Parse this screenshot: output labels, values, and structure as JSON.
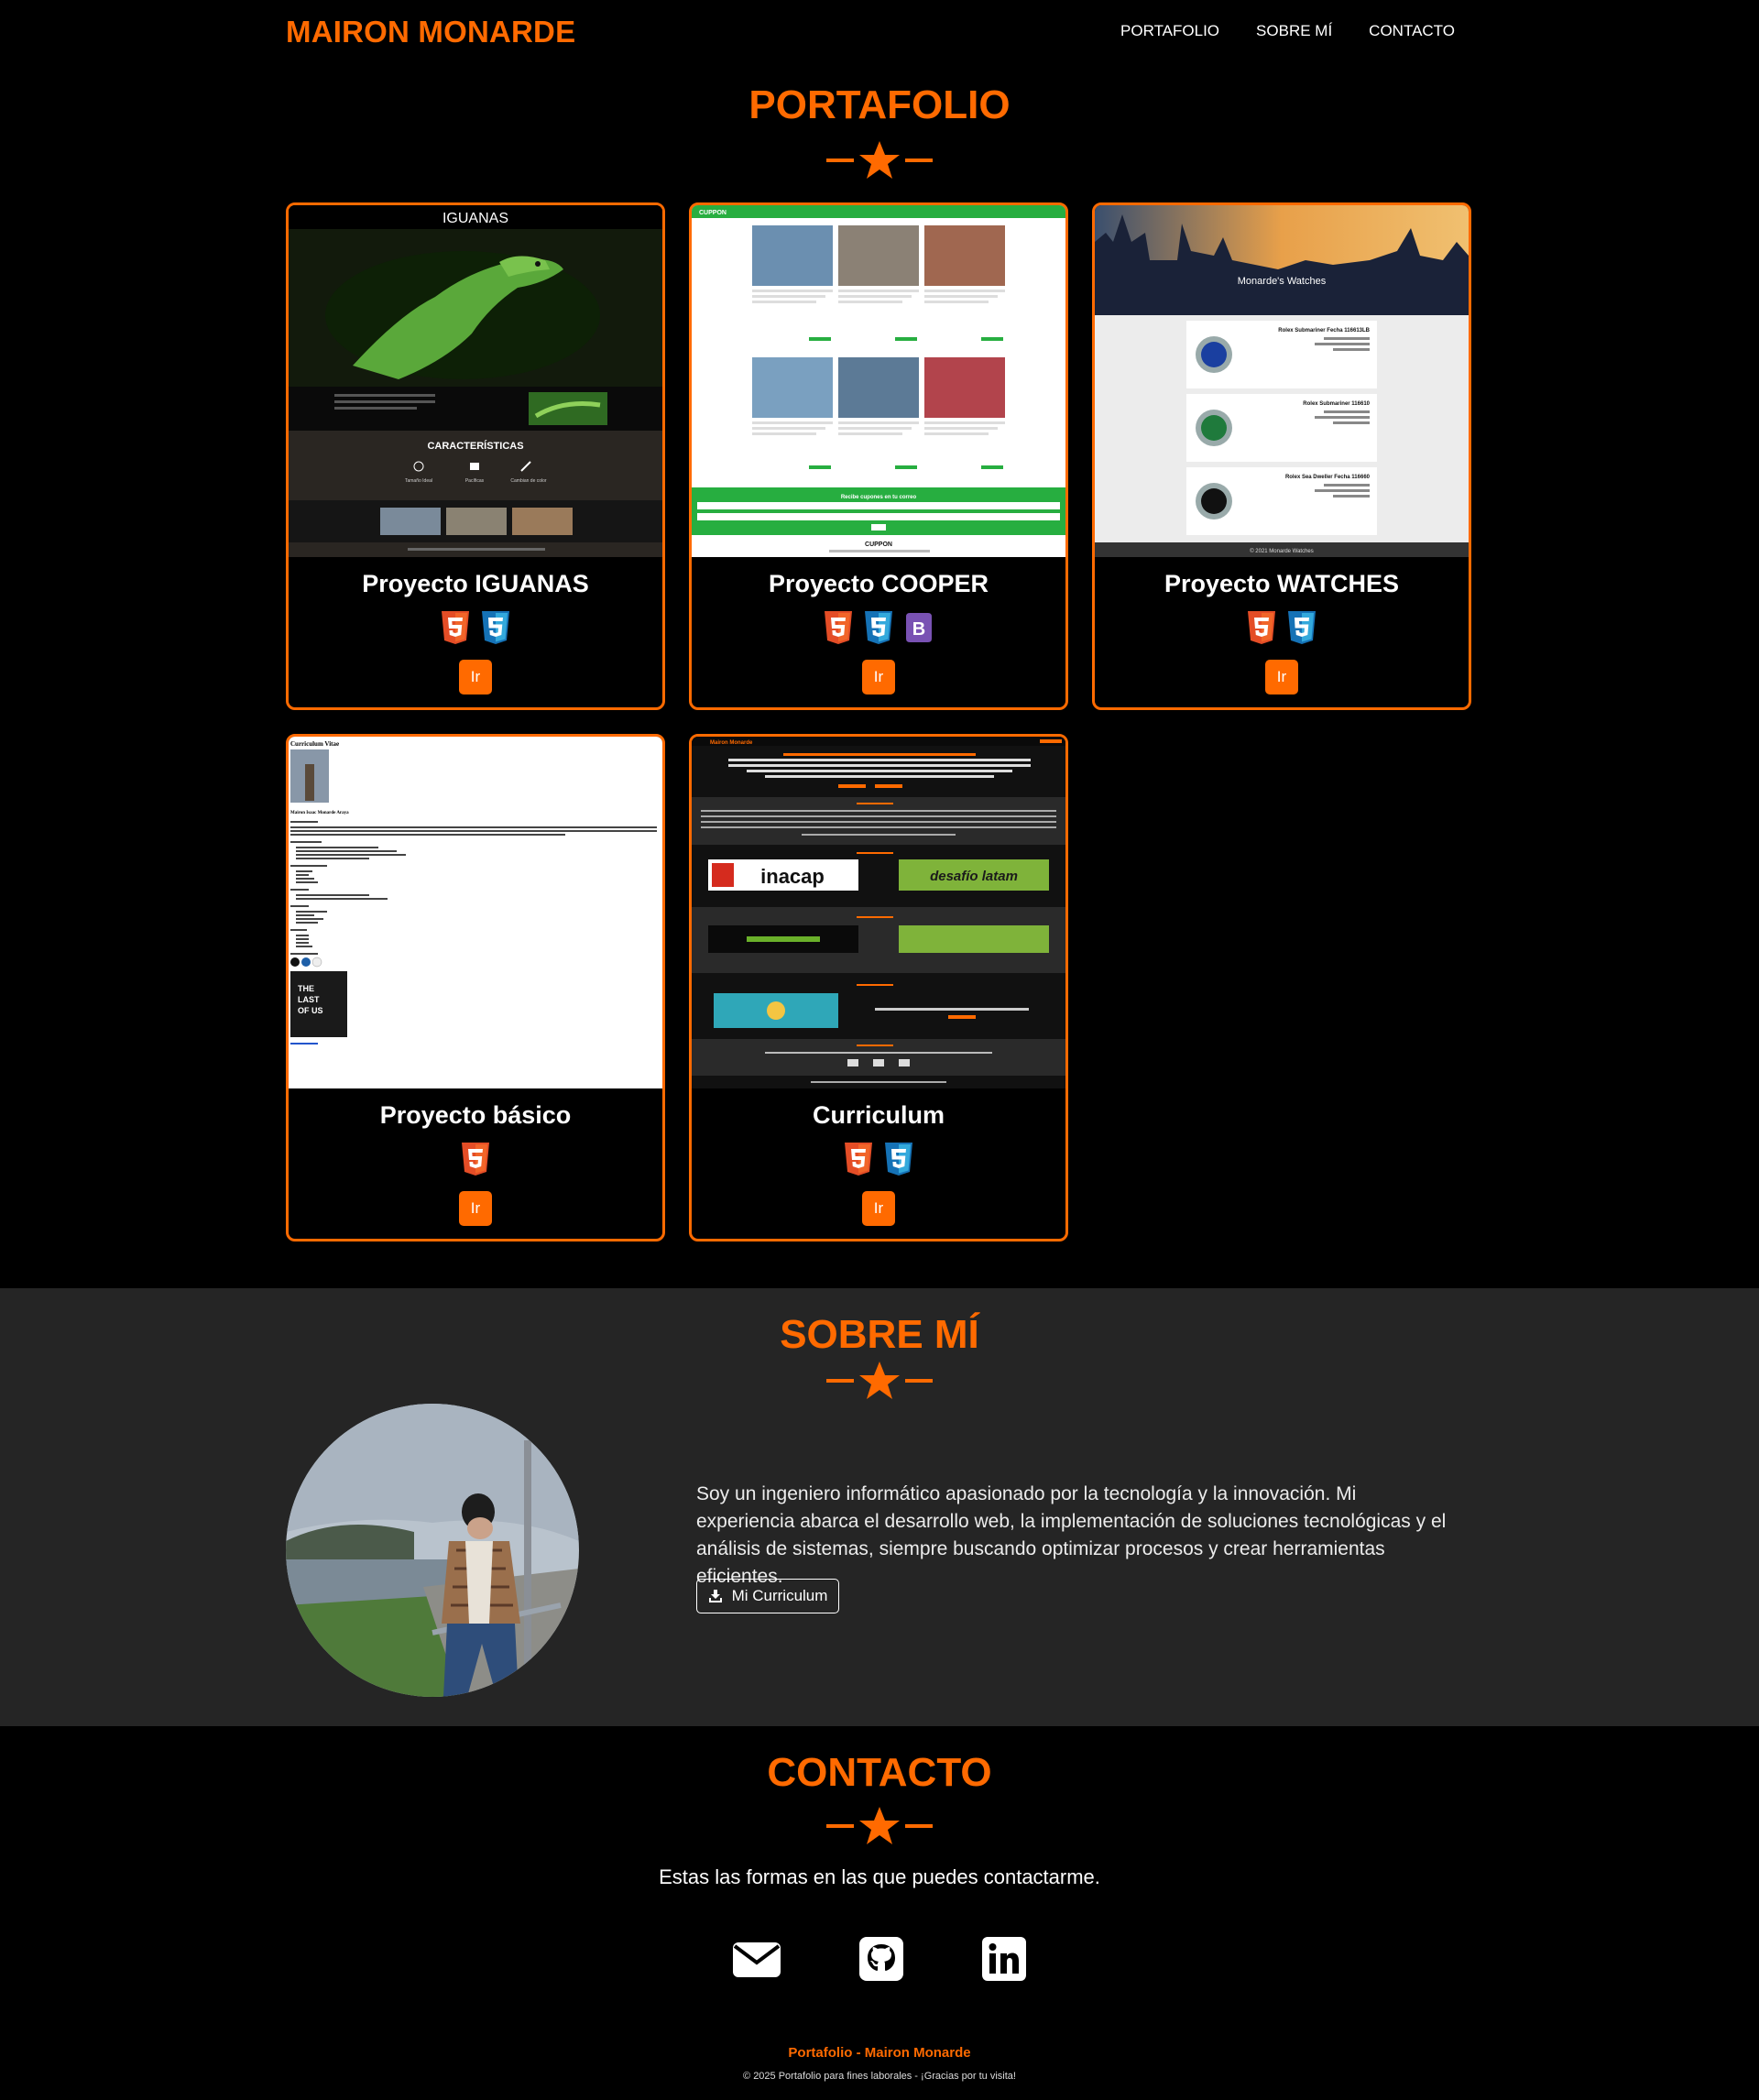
{
  "nav": {
    "brand": "MAIRON MONARDE",
    "links": [
      "PORTAFOLIO",
      "SOBRE MÍ",
      "CONTACTO"
    ]
  },
  "portfolio": {
    "title": "PORTAFOLIO",
    "projects": [
      {
        "title": "Proyecto IGUANAS",
        "button": "Ir",
        "tech": [
          "html5-icon",
          "css3-icon"
        ],
        "preview": {
          "heading": "IGUANAS",
          "section": "CARACTERÍSTICAS",
          "features": [
            "Tamaño Ideal",
            "Pacíficas",
            "Cambian de color"
          ]
        }
      },
      {
        "title": "Proyecto COOPER",
        "button": "Ir",
        "tech": [
          "html5-icon",
          "css3-icon",
          "bootstrap-icon"
        ],
        "preview": {
          "brand": "CUPPON",
          "subscribe": "Recibe cupones en tu correo",
          "footer_brand": "CUPPON"
        }
      },
      {
        "title": "Proyecto WATCHES",
        "button": "Ir",
        "tech": [
          "html5-icon",
          "css3-icon"
        ],
        "preview": {
          "banner": "Monarde's Watches",
          "items": [
            "Rolex Submariner Fecha 116613LB",
            "Rolex Submariner 116610",
            "Rolex Sea Dweller Fecha 116660"
          ],
          "footer": "© 2021 Monarde Watches"
        }
      },
      {
        "title": "Proyecto básico",
        "button": "Ir",
        "tech": [
          "html5-icon"
        ],
        "preview": {
          "heading": "Curriculum Vitae",
          "name": "Mairon Isaac Monarde Araya"
        }
      },
      {
        "title": "Curriculum",
        "button": "Ir",
        "tech": [
          "html5-icon",
          "css3-icon"
        ],
        "preview": {
          "brand": "Mairon Monarde",
          "logos": [
            "inacap",
            "desafío latam"
          ]
        }
      }
    ]
  },
  "about": {
    "title": "SOBRE MÍ",
    "text": "Soy un ingeniero informático apasionado por la tecnología y la innovación. Mi experiencia abarca el desarrollo web, la implementación de soluciones tecnológicas y el análisis de sistemas, siempre buscando optimizar procesos y crear herramientas eficientes.",
    "cv_button": "Mi Curriculum"
  },
  "contact": {
    "title": "CONTACTO",
    "subtitle": "Estas las formas en las que puedes contactarme.",
    "icons": [
      "email-icon",
      "github-icon",
      "linkedin-icon"
    ]
  },
  "footer": {
    "title": "Portafolio - Mairon Monarde",
    "copy": "© 2025 Portafolio para fines laborales - ¡Gracias por tu visita!"
  },
  "colors": {
    "accent": "#ff6a00",
    "about_bg": "#252525",
    "page_bg": "#000000"
  }
}
